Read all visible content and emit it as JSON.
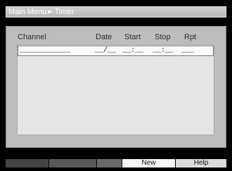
{
  "breadcrumb": {
    "parent": "Main Menu",
    "separator": "▶",
    "current": "Timer"
  },
  "columns": {
    "channel": "Channel",
    "date": "Date",
    "start": "Start",
    "stop": "Stop",
    "repeat": "Rpt"
  },
  "rows": [
    {
      "channel": "____________",
      "date": "__/__",
      "start": "__:__",
      "stop": "__:__",
      "repeat": "___"
    }
  ],
  "footer": {
    "new_label": "New",
    "help_label": "Help"
  },
  "colors": {
    "background": "#000000",
    "panel": "#bdbdbd",
    "list": "#e5e5e5",
    "selected_row": "#fafafa"
  }
}
